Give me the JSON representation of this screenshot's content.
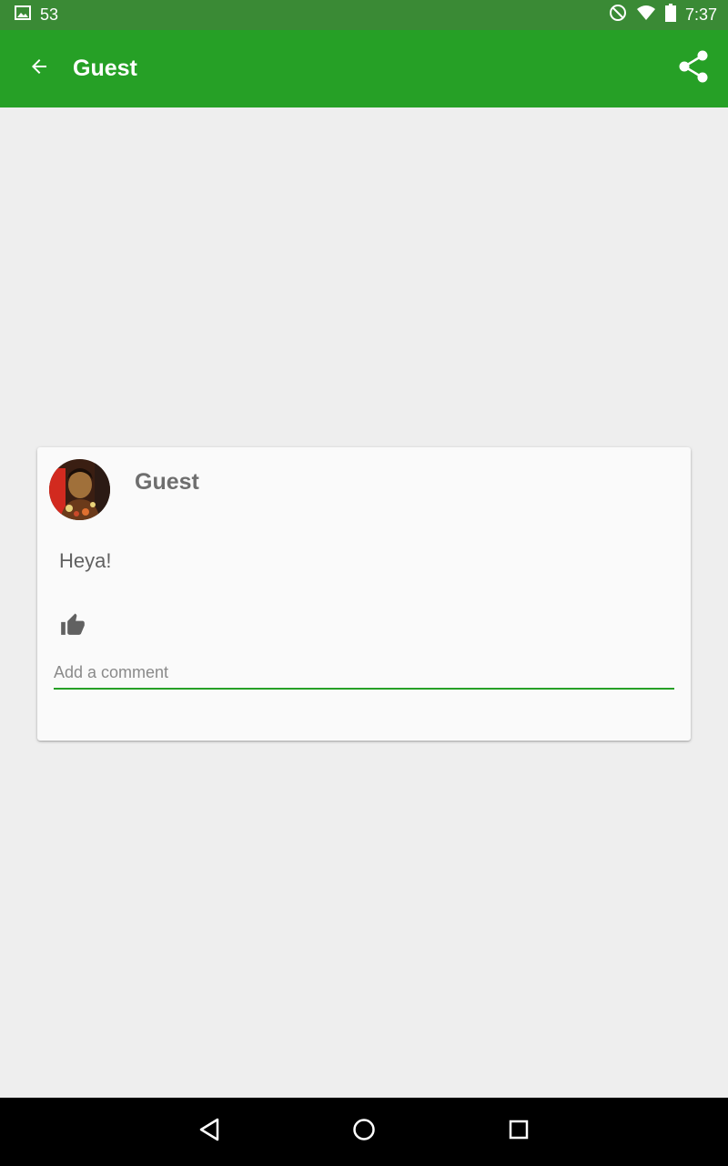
{
  "status_bar": {
    "notification_count": "53",
    "time": "7:37",
    "icons": [
      "image-icon",
      "do-not-disturb-icon",
      "wifi-icon",
      "battery-icon"
    ]
  },
  "app_bar": {
    "title": "Guest",
    "back_icon": "arrow-back-icon",
    "share_icon": "share-icon",
    "color": "#26a026"
  },
  "post": {
    "author": "Guest",
    "text": "Heya!",
    "avatar_icon": "avatar-photo",
    "like_icon": "thumb-up-icon",
    "comment": {
      "placeholder": "Add a comment",
      "value": ""
    }
  },
  "nav_bar": {
    "icons": [
      "back-triangle-icon",
      "home-circle-icon",
      "recents-square-icon"
    ]
  },
  "colors": {
    "status_bar": "#3a8a35",
    "accent": "#26a026",
    "background": "#eeeeee",
    "card": "#fafafa"
  }
}
